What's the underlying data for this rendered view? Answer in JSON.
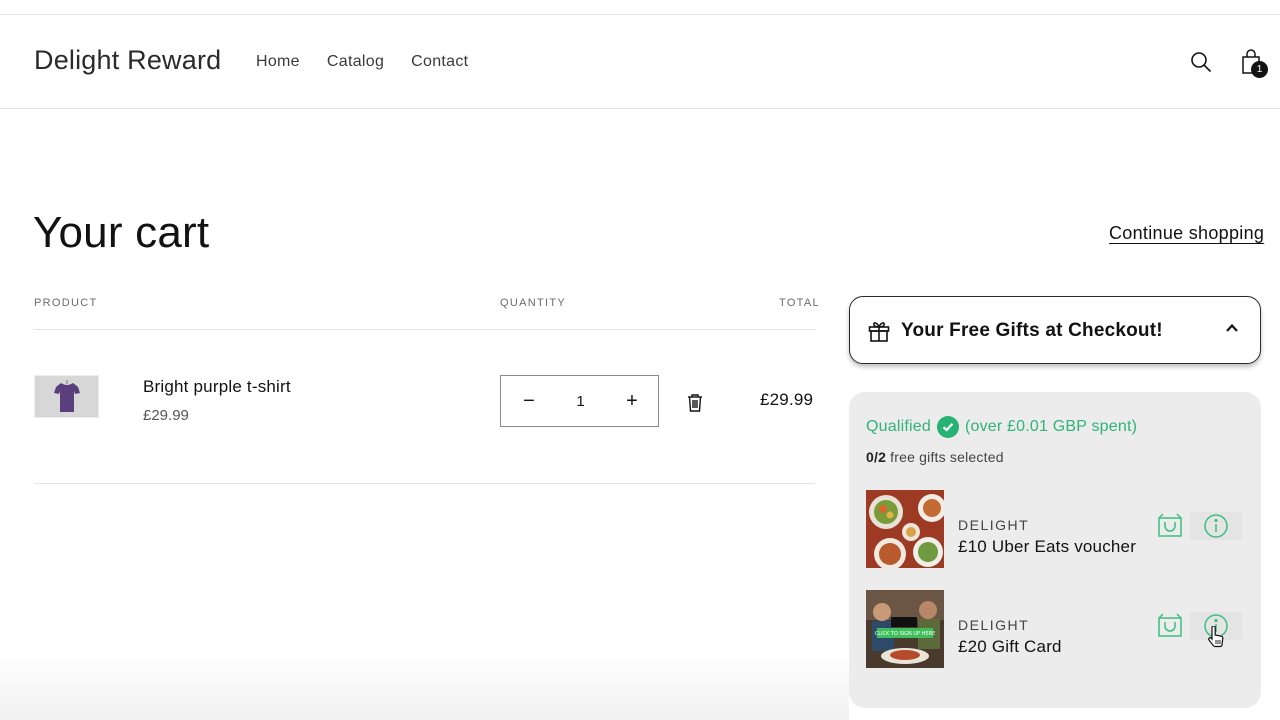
{
  "header": {
    "brand": "Delight Reward",
    "nav": [
      "Home",
      "Catalog",
      "Contact"
    ],
    "cart_count": "1"
  },
  "page": {
    "title": "Your cart",
    "continue_label": "Continue shopping"
  },
  "table": {
    "headers": {
      "product": "PRODUCT",
      "quantity": "QUANTITY",
      "total": "TOTAL"
    },
    "items": [
      {
        "name": "Bright purple t-shirt",
        "price": "£29.99",
        "quantity": "1",
        "total": "£29.99"
      }
    ]
  },
  "gifts": {
    "title": "Your Free Gifts at Checkout!",
    "qualified_label": "Qualified",
    "qualified_detail": "(over £0.01 GBP spent)",
    "selected_count": "0/2",
    "selected_suffix": "free gifts selected",
    "items": [
      {
        "brand": "DELIGHT",
        "name": "£10 Uber Eats voucher"
      },
      {
        "brand": "DELIGHT",
        "name": "£20 Gift Card",
        "image_text": "CLICK TO SIGN UP HERE"
      }
    ]
  },
  "colors": {
    "accent_green": "#2fb37a",
    "panel_bg": "#ececec",
    "text": "#121212"
  }
}
